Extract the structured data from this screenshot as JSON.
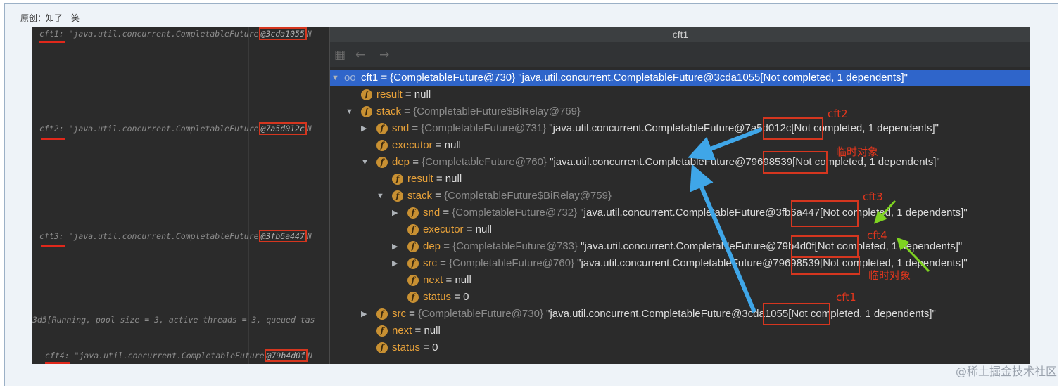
{
  "caption": "原创：知了一笑",
  "watermark": "@稀土掘金技术社区",
  "left_code": [
    {
      "var": "cft1:",
      "prefix": " \"java.util.concurrent.CompletableFuture",
      "hash": "@3cda1055",
      "suffix": "N"
    },
    {
      "var": "cft2:",
      "prefix": " \"java.util.concurrent.CompletableFuture",
      "hash": "@7a5d012c",
      "suffix": "N"
    },
    {
      "var": "cft3:",
      "prefix": " \"java.util.concurrent.CompletableFuture",
      "hash": "@3fb6a447",
      "suffix": "N"
    },
    {
      "var": "",
      "prefix": "3d5[Running, pool size = 3, active threads = 3, queued tas",
      "hash": "",
      "suffix": ""
    },
    {
      "var": "cft4:",
      "prefix": " \"java.util.concurrent.CompletableFuture",
      "hash": "@79b4d0f",
      "suffix": "N"
    }
  ],
  "popup": {
    "title": "cft1",
    "toolbar_icons": [
      "watch-icon",
      "back-arrow-icon",
      "forward-arrow-icon"
    ],
    "rows": [
      {
        "name": "cft1",
        "eq": " = ",
        "type": "",
        "value": "{CompletableFuture@730} \"java.util.concurrent.CompletableFuture@3cda1055[Not completed, 1 dependents]\""
      },
      {
        "name": "result",
        "eq": " = ",
        "type": "",
        "value": "null"
      },
      {
        "name": "stack",
        "eq": " = ",
        "type": "{CompletableFuture$BiRelay@769}",
        "value": ""
      },
      {
        "name": "snd",
        "eq": " = ",
        "type": "{CompletableFuture@731}",
        "value": " \"java.util.concurrent.CompletableFuture@7a5d012c[Not completed, 1 dependents]\""
      },
      {
        "name": "executor",
        "eq": " = ",
        "type": "",
        "value": "null"
      },
      {
        "name": "dep",
        "eq": " = ",
        "type": "{CompletableFuture@760}",
        "value": " \"java.util.concurrent.CompletableFuture@79698539[Not completed, 1 dependents]\""
      },
      {
        "name": "result",
        "eq": " = ",
        "type": "",
        "value": "null"
      },
      {
        "name": "stack",
        "eq": " = ",
        "type": "{CompletableFuture$BiRelay@759}",
        "value": ""
      },
      {
        "name": "snd",
        "eq": " = ",
        "type": "{CompletableFuture@732}",
        "value": " \"java.util.concurrent.CompletableFuture@3fb6a447[Not completed, 1 dependents]\""
      },
      {
        "name": "executor",
        "eq": " = ",
        "type": "",
        "value": "null"
      },
      {
        "name": "dep",
        "eq": " = ",
        "type": "{CompletableFuture@733}",
        "value": " \"java.util.concurrent.CompletableFuture@79b4d0f[Not completed, 1 dependents]\""
      },
      {
        "name": "src",
        "eq": " = ",
        "type": "{CompletableFuture@760}",
        "value": " \"java.util.concurrent.CompletableFuture@79698539[Not completed, 1 dependents]\""
      },
      {
        "name": "next",
        "eq": " = ",
        "type": "",
        "value": "null"
      },
      {
        "name": "status",
        "eq": " = ",
        "type": "",
        "value": "0"
      },
      {
        "name": "src",
        "eq": " = ",
        "type": "{CompletableFuture@730}",
        "value": " \"java.util.concurrent.CompletableFuture@3cda1055[Not completed, 1 dependents]\""
      },
      {
        "name": "next",
        "eq": " = ",
        "type": "",
        "value": "null"
      },
      {
        "name": "status",
        "eq": " = ",
        "type": "",
        "value": "0"
      }
    ]
  },
  "annotations": {
    "cft2": "cft2",
    "temp1": "临时对象",
    "cft3": "cft3",
    "cft4": "cft4",
    "temp2": "临时对象",
    "cft1": "cft1"
  },
  "colors": {
    "annotation_red": "#e2361d",
    "arrow_blue": "#3fa6e8",
    "arrow_green": "#7ed321",
    "selection_blue": "#2f65ca"
  }
}
